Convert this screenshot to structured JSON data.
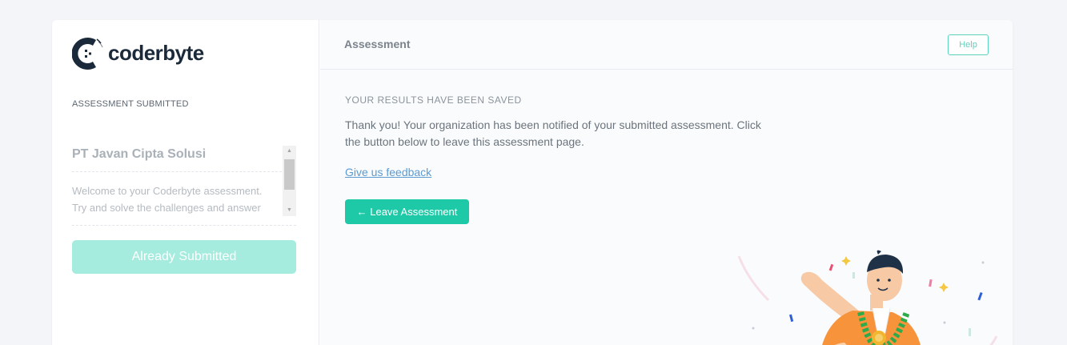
{
  "brand": {
    "name": "coderbyte"
  },
  "sidebar": {
    "status_label": "ASSESSMENT SUBMITTED",
    "organization": "PT Javan Cipta Solusi",
    "description_line1": "Welcome to your Coderbyte assessment.",
    "description_line2": "Try and solve the challenges and answer",
    "submit_button": "Already Submitted"
  },
  "header": {
    "title": "Assessment",
    "help_button": "Help"
  },
  "content": {
    "heading": "YOUR RESULTS HAVE BEEN SAVED",
    "message_line1": "Thank you! Your organization has been notified of your submitted assessment. Click",
    "message_line2": "the button below to leave this assessment page.",
    "feedback_link": "Give us feedback",
    "leave_button": "← Leave Assessment"
  },
  "colors": {
    "accent": "#1ec9a8",
    "accent_light": "#a5ebde",
    "help_border": "#5ed1bd",
    "link": "#5b9bd1",
    "brand_dark": "#1b2a3a"
  },
  "icons": {
    "logo": "coderbyte-logo-icon",
    "scroll_up": "chevron-up-icon",
    "scroll_down": "chevron-down-icon",
    "illustration": "celebrating-person-illustration"
  }
}
